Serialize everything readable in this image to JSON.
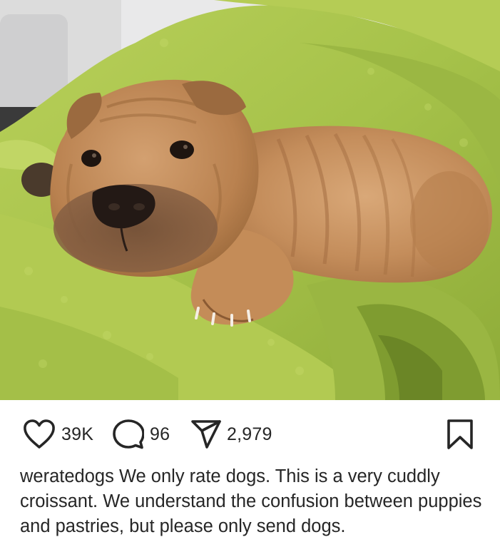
{
  "post": {
    "image": {
      "subject": "sleeping-puppy-photo"
    }
  },
  "actions": {
    "likes": "39K",
    "comments": "96",
    "shares": "2,979",
    "icons": {
      "like": "heart-icon",
      "comment": "comment-bubble-icon",
      "share": "paper-plane-icon",
      "save": "bookmark-icon"
    }
  },
  "caption": {
    "username": "weratedogs",
    "text": "We only rate dogs. This is a very cuddly croissant. We understand the confusion between puppies and pastries, but please only send dogs."
  },
  "colors": {
    "text": "#262626",
    "background": "#ffffff"
  }
}
